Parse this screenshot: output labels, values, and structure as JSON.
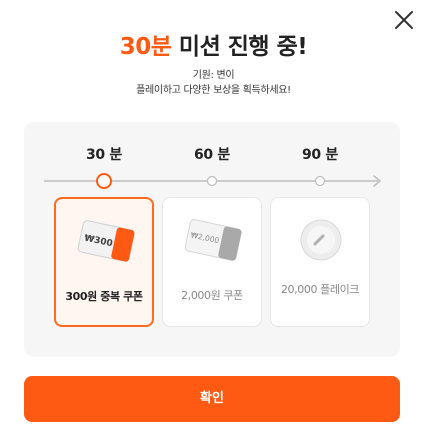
{
  "header": {
    "title_accent": "30분",
    "title_rest": " 미션 진행 중!",
    "meta": "기원: 변이",
    "subtitle": "플레이하고 다양한 보상을 획득하세요!"
  },
  "steps": [
    {
      "label": "30 분",
      "state": "current"
    },
    {
      "label": "60 분",
      "state": "pending"
    },
    {
      "label": "90 분",
      "state": "pending"
    }
  ],
  "rewards": [
    {
      "label": "300원 중복 쿠폰",
      "art_text": "₩300",
      "icon": "coupon-icon",
      "active": true
    },
    {
      "label": "2,000원 쿠폰",
      "art_text": "₩2,000",
      "icon": "coupon-icon",
      "active": false
    },
    {
      "label": "20,000 플레이크",
      "icon": "flake-coin-icon",
      "active": false
    }
  ],
  "confirm_label": "확인",
  "colors": {
    "accent": "#ff5a14",
    "panel": "#f6f6f6",
    "muted": "#888888"
  },
  "close_icon": "close-icon"
}
